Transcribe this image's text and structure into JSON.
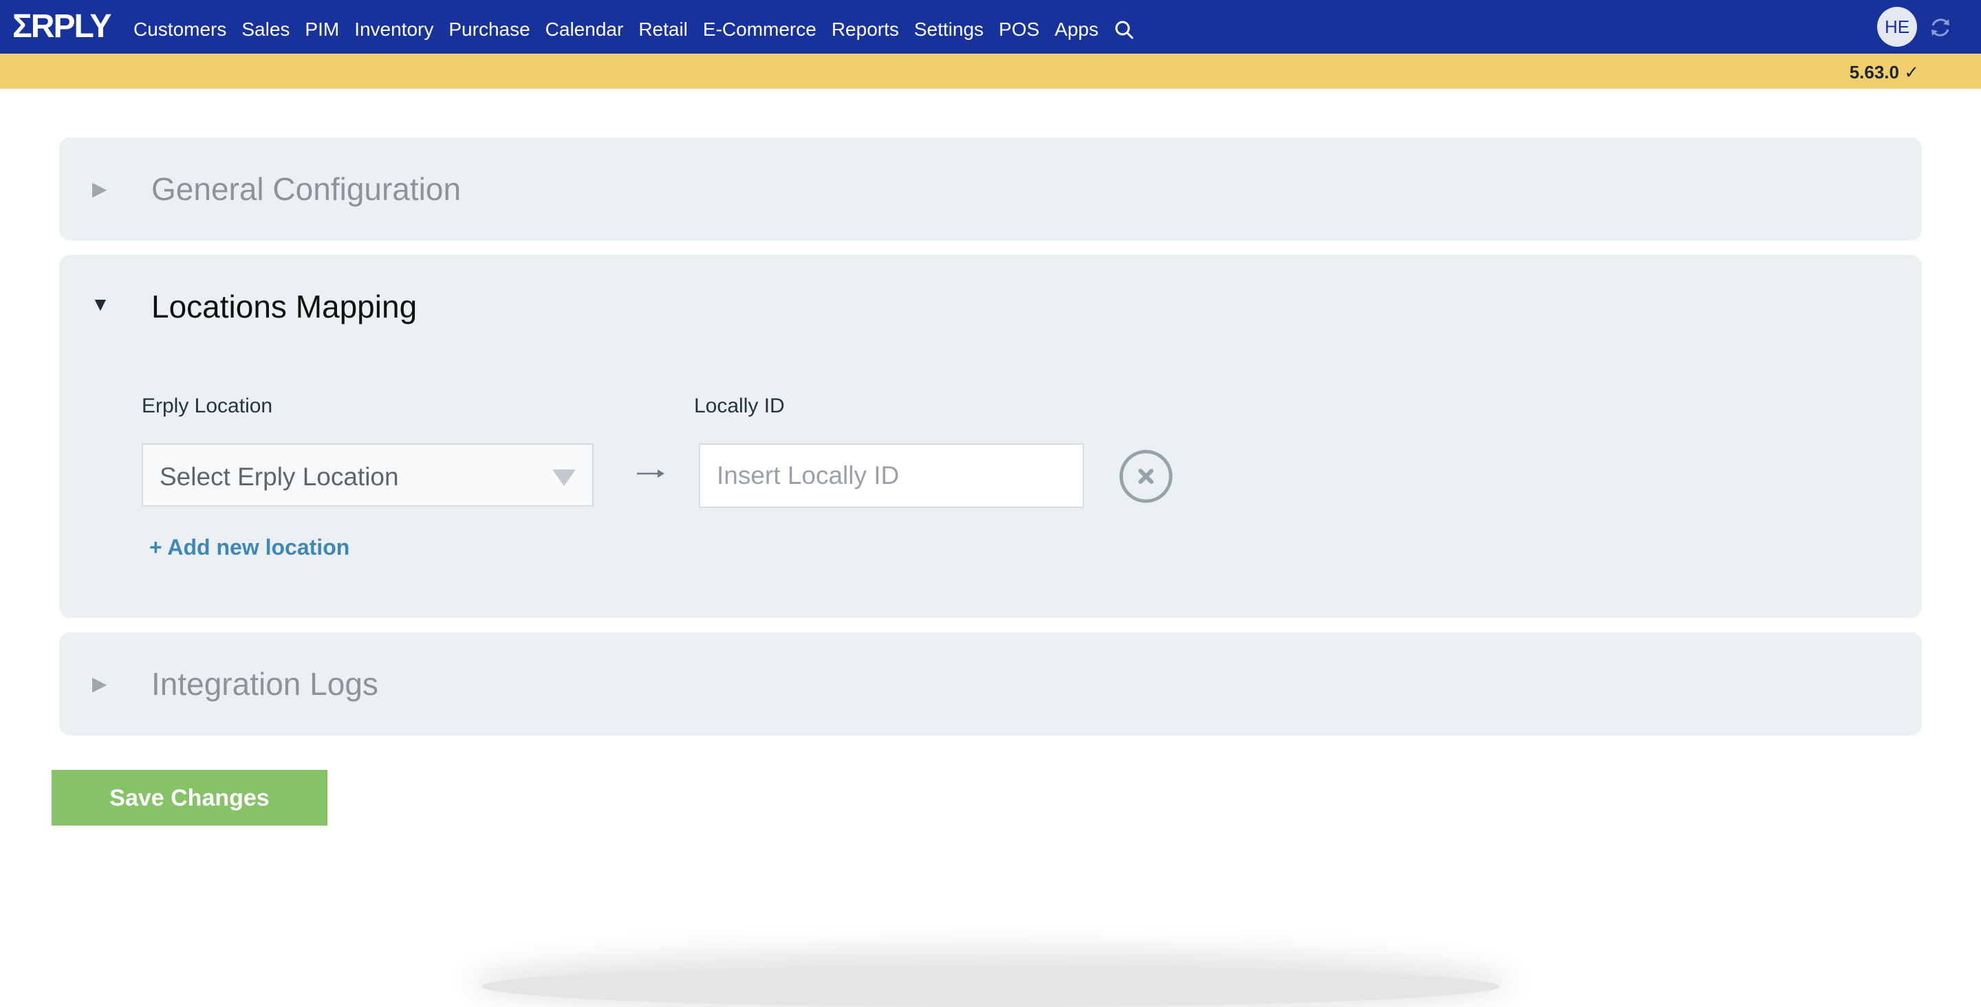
{
  "header": {
    "logo_text": "ΣRPLY",
    "nav_items": [
      "Customers",
      "Sales",
      "PIM",
      "Inventory",
      "Purchase",
      "Calendar",
      "Retail",
      "E-Commerce",
      "Reports",
      "Settings",
      "POS",
      "Apps"
    ],
    "search_icon": "search-icon",
    "avatar_initials": "HE",
    "refresh_icon": "refresh-icon"
  },
  "version_bar": {
    "version": "5.63.0 ✓"
  },
  "panels": {
    "general": {
      "title": "General Configuration",
      "caret": "▶"
    },
    "locations": {
      "title": "Locations Mapping",
      "caret": "▼",
      "erply_location_label": "Erply Location",
      "erply_location_select": "Select Erply Location",
      "locally_id_label": "Locally ID",
      "locally_id_placeholder": "Insert Locally ID",
      "locally_id_value": "",
      "add_link": "+ Add new location"
    },
    "logs": {
      "title": "Integration Logs",
      "caret": "▶"
    }
  },
  "actions": {
    "save_label": "Save Changes"
  },
  "colors": {
    "header_bg": "#17329b",
    "version_bar_bg": "#f0cf6c",
    "panel_bg": "#ebf0f3",
    "save_button": "#86c266",
    "link": "#3e88b8"
  }
}
